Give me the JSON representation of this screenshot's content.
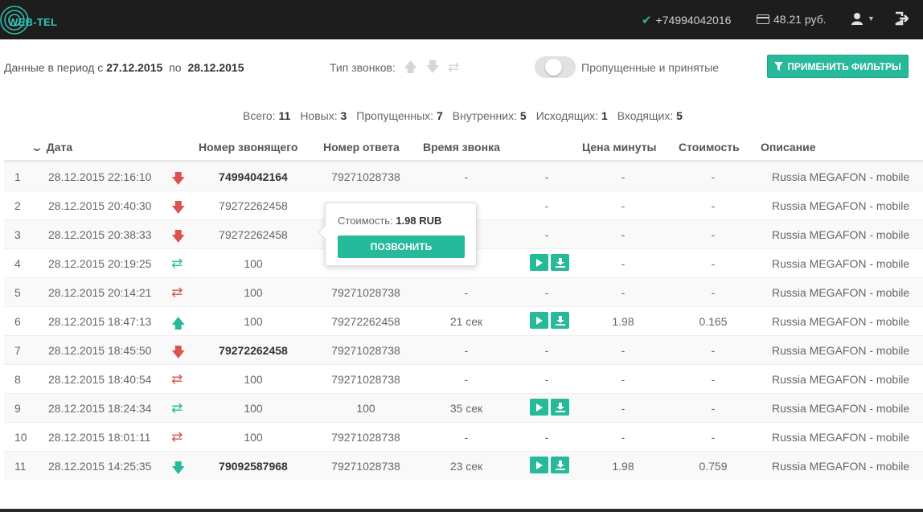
{
  "header": {
    "logo_text": "WEB-TEL",
    "phone": "+74994042016",
    "balance": "48.21 руб.",
    "accent": "#26b99a"
  },
  "filters": {
    "period_prefix": "Данные в период с",
    "date_from": "27.12.2015",
    "period_mid": "по",
    "date_to": "28.12.2015",
    "call_type_label": "Тип звонков:",
    "call_type_icons": [
      "arrow-up-icon",
      "arrow-down-icon",
      "exchange-icon"
    ],
    "toggle_label": "Пропущенные и принятые",
    "apply_button": "ПРИМЕНИТЬ ФИЛЬТРЫ"
  },
  "summary": {
    "total_label": "Всего:",
    "total": "11",
    "new_label": "Новых:",
    "new": "3",
    "missed_label": "Пропущенных:",
    "missed": "7",
    "internal_label": "Внутренних:",
    "internal": "5",
    "outgoing_label": "Исходящих:",
    "outgoing": "1",
    "incoming_label": "Входящих:",
    "incoming": "5"
  },
  "table": {
    "headers": {
      "date": "Дата",
      "from": "Номер звонящего",
      "to": "Номер ответа",
      "duration": "Время звонка",
      "price": "Цена минуты",
      "cost": "Стоимость",
      "desc": "Описание"
    },
    "rows": [
      {
        "n": "1",
        "date": "28.12.2015 22:16:10",
        "type": "missed",
        "from": "74994042164",
        "bold": true,
        "to": "79271028738",
        "duration": "-",
        "actions": false,
        "extra": "-",
        "price": "-",
        "cost": "-",
        "desc": "Russia MEGAFON - mobile"
      },
      {
        "n": "2",
        "date": "28.12.2015 20:40:30",
        "type": "missed",
        "from": "79272262458",
        "bold": false,
        "to": "",
        "duration": "",
        "actions": false,
        "extra": "-",
        "price": "-",
        "cost": "-",
        "desc": "Russia MEGAFON - mobile"
      },
      {
        "n": "3",
        "date": "28.12.2015 20:38:33",
        "type": "missed",
        "from": "79272262458",
        "bold": false,
        "to": "",
        "duration": "",
        "actions": false,
        "extra": "-",
        "price": "-",
        "cost": "-",
        "desc": "Russia MEGAFON - mobile"
      },
      {
        "n": "4",
        "date": "28.12.2015 20:19:25",
        "type": "internal-ok",
        "from": "100",
        "bold": false,
        "to": "",
        "duration": "",
        "actions": true,
        "extra": "",
        "price": "-",
        "cost": "-",
        "desc": "Russia MEGAFON - mobile"
      },
      {
        "n": "5",
        "date": "28.12.2015 20:14:21",
        "type": "internal-missed",
        "from": "100",
        "bold": false,
        "to": "79271028738",
        "duration": "-",
        "actions": false,
        "extra": "-",
        "price": "-",
        "cost": "-",
        "desc": "Russia MEGAFON - mobile"
      },
      {
        "n": "6",
        "date": "28.12.2015 18:47:13",
        "type": "outgoing",
        "from": "100",
        "bold": false,
        "to": "79272262458",
        "duration": "21 сек",
        "actions": true,
        "extra": "",
        "price": "1.98",
        "cost": "0.165",
        "desc": "Russia MEGAFON - mobile"
      },
      {
        "n": "7",
        "date": "28.12.2015 18:45:50",
        "type": "missed",
        "from": "79272262458",
        "bold": true,
        "to": "79271028738",
        "duration": "-",
        "actions": false,
        "extra": "-",
        "price": "-",
        "cost": "-",
        "desc": "Russia MEGAFON - mobile"
      },
      {
        "n": "8",
        "date": "28.12.2015 18:40:54",
        "type": "internal-missed",
        "from": "100",
        "bold": false,
        "to": "79271028738",
        "duration": "-",
        "actions": false,
        "extra": "-",
        "price": "-",
        "cost": "-",
        "desc": "Russia MEGAFON - mobile"
      },
      {
        "n": "9",
        "date": "28.12.2015 18:24:34",
        "type": "internal-ok",
        "from": "100",
        "bold": false,
        "to": "100",
        "duration": "35 сек",
        "actions": true,
        "extra": "",
        "price": "-",
        "cost": "-",
        "desc": "Russia MEGAFON - mobile"
      },
      {
        "n": "10",
        "date": "28.12.2015 18:01:11",
        "type": "internal-missed",
        "from": "100",
        "bold": false,
        "to": "79271028738",
        "duration": "-",
        "actions": false,
        "extra": "-",
        "price": "-",
        "cost": "-",
        "desc": "Russia MEGAFON - mobile"
      },
      {
        "n": "11",
        "date": "28.12.2015 14:25:35",
        "type": "incoming",
        "from": "79092587968",
        "bold": true,
        "to": "79271028738",
        "duration": "23 сек",
        "actions": true,
        "extra": "",
        "price": "1.98",
        "cost": "0.759",
        "desc": "Russia MEGAFON - mobile"
      }
    ]
  },
  "popover": {
    "cost_label": "Стоимость:",
    "cost_value": "1.98 RUB",
    "call_button": "ПОЗВОНИТЬ"
  }
}
